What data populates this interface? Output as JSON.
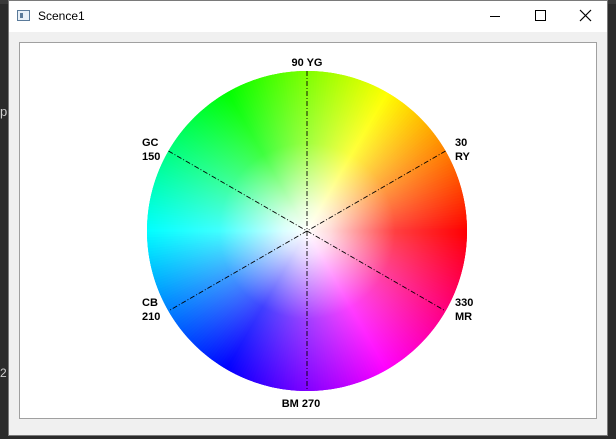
{
  "window": {
    "title": "Scence1"
  },
  "background": {
    "left_char_1": "p",
    "left_char_2": "2"
  },
  "wheel": {
    "labels": [
      {
        "line1": "90 YG",
        "line2": ""
      },
      {
        "line1": "30",
        "line2": "RY"
      },
      {
        "line1": "GC",
        "line2": "150"
      },
      {
        "line1": "CB",
        "line2": "210"
      },
      {
        "line1": "330",
        "line2": "MR"
      },
      {
        "line1": "BM 270",
        "line2": ""
      }
    ],
    "axes_deg": [
      90,
      30,
      150
    ],
    "segments": 360
  },
  "icons": {
    "app": "app-window-icon",
    "minimize": "minimize-icon",
    "maximize": "maximize-icon",
    "close": "close-icon"
  }
}
